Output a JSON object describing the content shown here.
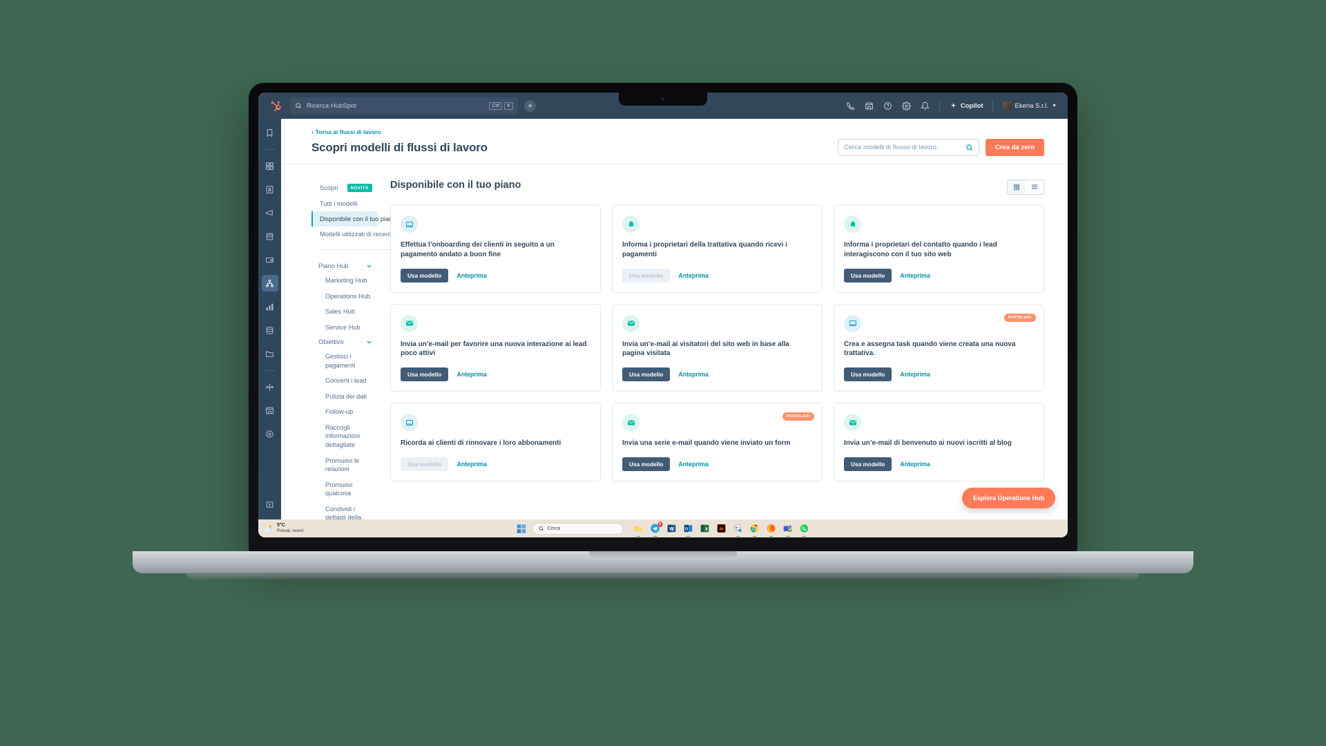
{
  "topbar": {
    "search_placeholder": "Ricerca HubSpot",
    "kbd_ctrl": "Ctrl",
    "kbd_key": "K",
    "plus_label": "+",
    "copilot_label": "Copilot",
    "account_label": "Ekeria S.r.l.",
    "icons": [
      "phone-icon",
      "marketplace-icon",
      "help-icon",
      "settings-icon",
      "notifications-icon"
    ]
  },
  "rail": {
    "items": [
      {
        "name": "hubspot-logo-icon"
      },
      {
        "name": "bookmark-icon"
      },
      {
        "name": "grid-apps-icon"
      },
      {
        "name": "contacts-icon"
      },
      {
        "name": "megaphone-icon"
      },
      {
        "name": "inbox-icon"
      },
      {
        "name": "deals-icon"
      },
      {
        "name": "automation-workflows-icon"
      },
      {
        "name": "reports-icon"
      },
      {
        "name": "data-icon"
      },
      {
        "name": "library-folder-icon"
      },
      {
        "name": "integrations-icon"
      },
      {
        "name": "marketplace-icon"
      },
      {
        "name": "settings-gear-icon"
      },
      {
        "name": "expand-panel-icon"
      }
    ]
  },
  "header": {
    "breadcrumb": "Torna ai flussi di lavoro",
    "title": "Scopri modelli di flussi di lavoro",
    "search_placeholder": "Cerca modelli di flusso di lavoro",
    "create_button": "Crea da zero"
  },
  "filters": {
    "primary": [
      {
        "label": "Scopri",
        "badge": "NOVITÀ",
        "selected": false
      },
      {
        "label": "Tutti i modelli",
        "badge": "",
        "selected": false
      },
      {
        "label": "Disponibile con il tuo piano",
        "badge": "",
        "selected": true
      },
      {
        "label": "Modelli utilizzati di recente",
        "badge": "",
        "selected": false
      }
    ],
    "groups": [
      {
        "label": "Piano Hub",
        "items": [
          "Marketing Hub",
          "Operations Hub",
          "Sales Hub",
          "Service Hub"
        ]
      },
      {
        "label": "Obiettivo",
        "items": [
          "Gestisci i pagamenti",
          "Converti i lead",
          "Pulizia dei dati",
          "Follow-up",
          "Raccogli informazioni dettagliate",
          "Promuovi le relazioni",
          "Promuovi qualcosa",
          "Condividi i dettagli della"
        ]
      }
    ]
  },
  "main": {
    "section_title": "Disponibile con il tuo piano",
    "view_toggle": {
      "grid_label": "grid-view-icon",
      "list_label": "list-view-icon",
      "active": "list"
    },
    "use_template_label": "Usa modello",
    "preview_label": "Anteprima",
    "popular_badge": "POPOLARI",
    "cards": [
      {
        "title": "Effettua l’onboarding dei clienti in seguito a un pagamento andato a buon fine",
        "icon": "monitor-icon",
        "icon_color": "blue",
        "disabled": false,
        "popular": false
      },
      {
        "title": "Informa i proprietari della trattativa quando ricevi i pagamenti",
        "icon": "bell-icon",
        "icon_color": "green",
        "disabled": true,
        "popular": false
      },
      {
        "title": "Informa i proprietari del contatto quando i lead interagiscono con il tuo sito web",
        "icon": "bell-icon",
        "icon_color": "green",
        "disabled": false,
        "popular": false
      },
      {
        "title": "Invia un’e-mail per favorire una nuova interazione ai lead poco attivi",
        "icon": "envelope-icon",
        "icon_color": "green",
        "disabled": false,
        "popular": false
      },
      {
        "title": "Invia un’e-mail ai visitatori del sito web in base alla pagina visitata",
        "icon": "envelope-icon",
        "icon_color": "green",
        "disabled": false,
        "popular": false
      },
      {
        "title": "Crea e assegna task quando viene creata una nuova trattativa.",
        "icon": "monitor-icon",
        "icon_color": "blue",
        "disabled": false,
        "popular": true
      },
      {
        "title": "Ricorda ai clienti di rinnovare i loro abbonamenti",
        "icon": "monitor-icon",
        "icon_color": "blue",
        "disabled": true,
        "popular": false
      },
      {
        "title": "Invia una serie e-mail quando viene inviato un form",
        "icon": "envelope-icon",
        "icon_color": "green",
        "disabled": false,
        "popular": true
      },
      {
        "title": "Invia un’e-mail di benvenuto ai nuovi iscritti al blog",
        "icon": "envelope-icon",
        "icon_color": "green",
        "disabled": false,
        "popular": false
      }
    ],
    "float_cta": "Esplora Operations Hub"
  },
  "taskbar": {
    "weather_temp": "5°C",
    "weather_desc": "Preval. nuvol.",
    "search_placeholder": "Cerca",
    "telegram_badge": "9",
    "apps": [
      "file-explorer-icon",
      "telegram-icon",
      "word-icon",
      "outlook-icon",
      "excel-icon",
      "illustrator-icon",
      "snipping-tool-icon",
      "chrome-icon",
      "firefox-icon",
      "teams-icon",
      "whatsapp-icon"
    ]
  },
  "colors": {
    "hubspot_orange": "#ff7a59",
    "hubspot_navy": "#33475b",
    "teal": "#00a4bd",
    "green": "#00bda5"
  }
}
